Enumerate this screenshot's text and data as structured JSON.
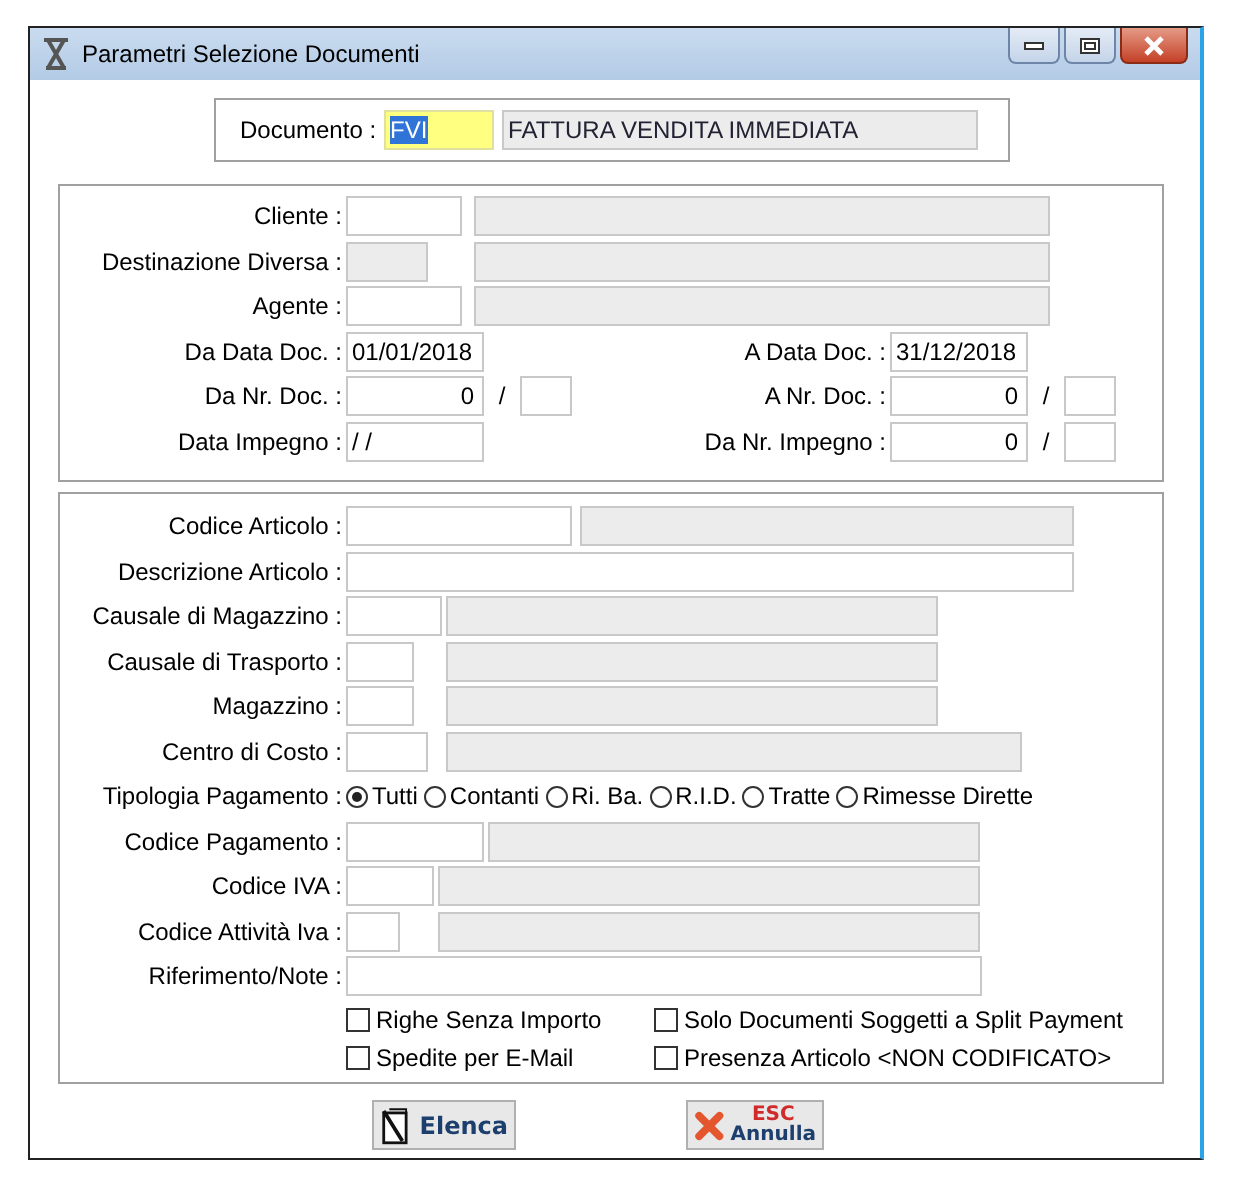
{
  "window": {
    "title": "Parametri Selezione Documenti"
  },
  "document": {
    "label": "Documento :",
    "code": {
      "value": "FVI",
      "selected": true
    },
    "description": "FATTURA VENDITA IMMEDIATA"
  },
  "filters": [
    {
      "label": "Cliente :",
      "disabled": false
    },
    {
      "label": "Destinazione Diversa :",
      "disabled": true
    },
    {
      "label": "Agente :",
      "disabled": false
    }
  ],
  "ranges": [
    {
      "kind": "date",
      "from": {
        "label": "Da Data Doc. :",
        "value": "01/01/2018"
      },
      "to": {
        "label": "A Data Doc. :",
        "value": "31/12/2018"
      }
    },
    {
      "kind": "number",
      "separator": "/",
      "from": {
        "label": "Da Nr. Doc. :",
        "value": "0"
      },
      "to": {
        "label": "A Nr. Doc. :",
        "value": "0"
      }
    },
    {
      "kind": "mixed",
      "separator": "/",
      "from": {
        "label": "Data Impegno :",
        "value": "/ /"
      },
      "to": {
        "label": "Da Nr. Impegno :",
        "value": "0"
      }
    }
  ],
  "articles": [
    {
      "kind": "lookup",
      "label": "Codice Articolo :"
    },
    {
      "kind": "text",
      "label": "Descrizione Articolo :"
    },
    {
      "kind": "lookup",
      "label": "Causale di Magazzino :"
    },
    {
      "kind": "lookup",
      "label": "Causale di Trasporto :"
    },
    {
      "kind": "lookup",
      "label": "Magazzino :"
    },
    {
      "kind": "lookup",
      "label": "Centro di Costo :"
    },
    {
      "kind": "radio",
      "label": "Tipologia Pagamento :",
      "options": [
        {
          "label": "Tutti",
          "selected": true
        },
        {
          "label": "Contanti",
          "selected": false
        },
        {
          "label": "Ri. Ba.",
          "selected": false
        },
        {
          "label": "R.I.D.",
          "selected": false
        },
        {
          "label": "Tratte",
          "selected": false
        },
        {
          "label": "Rimesse Dirette",
          "selected": false
        }
      ]
    },
    {
      "kind": "lookup",
      "label": "Codice Pagamento :"
    },
    {
      "kind": "lookup",
      "label": "Codice IVA :"
    },
    {
      "kind": "lookup",
      "label": "Codice Attività Iva :"
    },
    {
      "kind": "text",
      "label": "Riferimento/Note :"
    }
  ],
  "options": [
    {
      "label": "Righe Senza Importo",
      "checked": false
    },
    {
      "label": "Solo Documenti Soggetti a Split Payment",
      "checked": false
    },
    {
      "label": "Spedite per E-Mail",
      "checked": false
    },
    {
      "label": "Presenza Articolo <NON CODIFICATO>",
      "checked": false
    }
  ],
  "buttons": [
    {
      "kind": "list",
      "label": "Elenca"
    },
    {
      "kind": "cancel",
      "key": "ESC",
      "label": "Annulla"
    }
  ]
}
